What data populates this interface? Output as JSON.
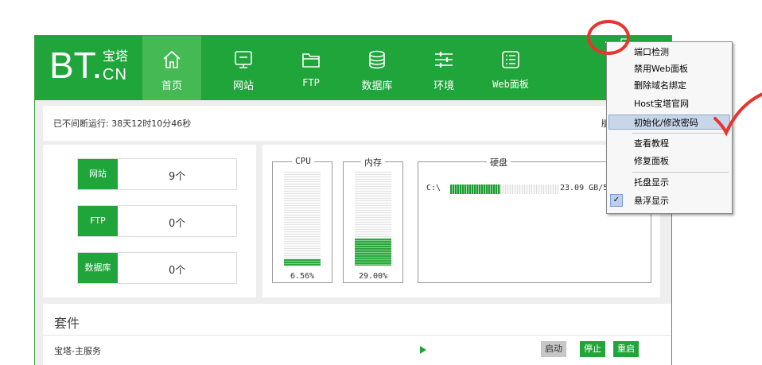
{
  "logo": {
    "bt": "BT.",
    "cn_top": "宝塔",
    "cn_bottom": "CN"
  },
  "nav": [
    {
      "label": "首页",
      "icon": "home-icon",
      "active": true
    },
    {
      "label": "网站",
      "icon": "monitor-icon",
      "active": false
    },
    {
      "label": "FTP",
      "icon": "folder-icon",
      "active": false
    },
    {
      "label": "数据库",
      "icon": "database-icon",
      "active": false
    },
    {
      "label": "环境",
      "icon": "sliders-icon",
      "active": false
    },
    {
      "label": "Web面板",
      "icon": "list-icon",
      "active": false
    }
  ],
  "status": {
    "uptime": "已不间断运行: 38天12时10分46秒",
    "version_partial": "版本"
  },
  "stats": [
    {
      "label": "网站",
      "value": "9个"
    },
    {
      "label": "FTP",
      "value": "0个"
    },
    {
      "label": "数据库",
      "value": "0个"
    }
  ],
  "cpu": {
    "label": "CPU",
    "percent_text": "6.56%",
    "percent": 6.56
  },
  "memory": {
    "label": "内存",
    "percent_text": "29.00%",
    "percent": 29.0
  },
  "disk": {
    "label": "硬盘",
    "drive": "C:\\",
    "size_text": "23.09 GB/5",
    "used_fraction": 0.46
  },
  "suite": {
    "title": "套件",
    "service": "宝塔-主服务",
    "start": "启动",
    "stop": "停止",
    "restart": "重启"
  },
  "menu": {
    "items": [
      {
        "label": "端口检测"
      },
      {
        "label": "禁用Web面板"
      },
      {
        "label": "删除域名绑定"
      },
      {
        "label": "Host宝塔官网"
      },
      {
        "label": "初始化/修改密码",
        "highlighted": true
      },
      {
        "label": "查看教程"
      },
      {
        "label": "修复面板"
      },
      {
        "label": "托盘显示"
      },
      {
        "label": "悬浮显示",
        "checked": true
      }
    ],
    "check_glyph": "✓"
  },
  "colors": {
    "brand": "#20a53a",
    "annotation": "#e8342e",
    "menu_highlight": "#c8d6ea"
  }
}
